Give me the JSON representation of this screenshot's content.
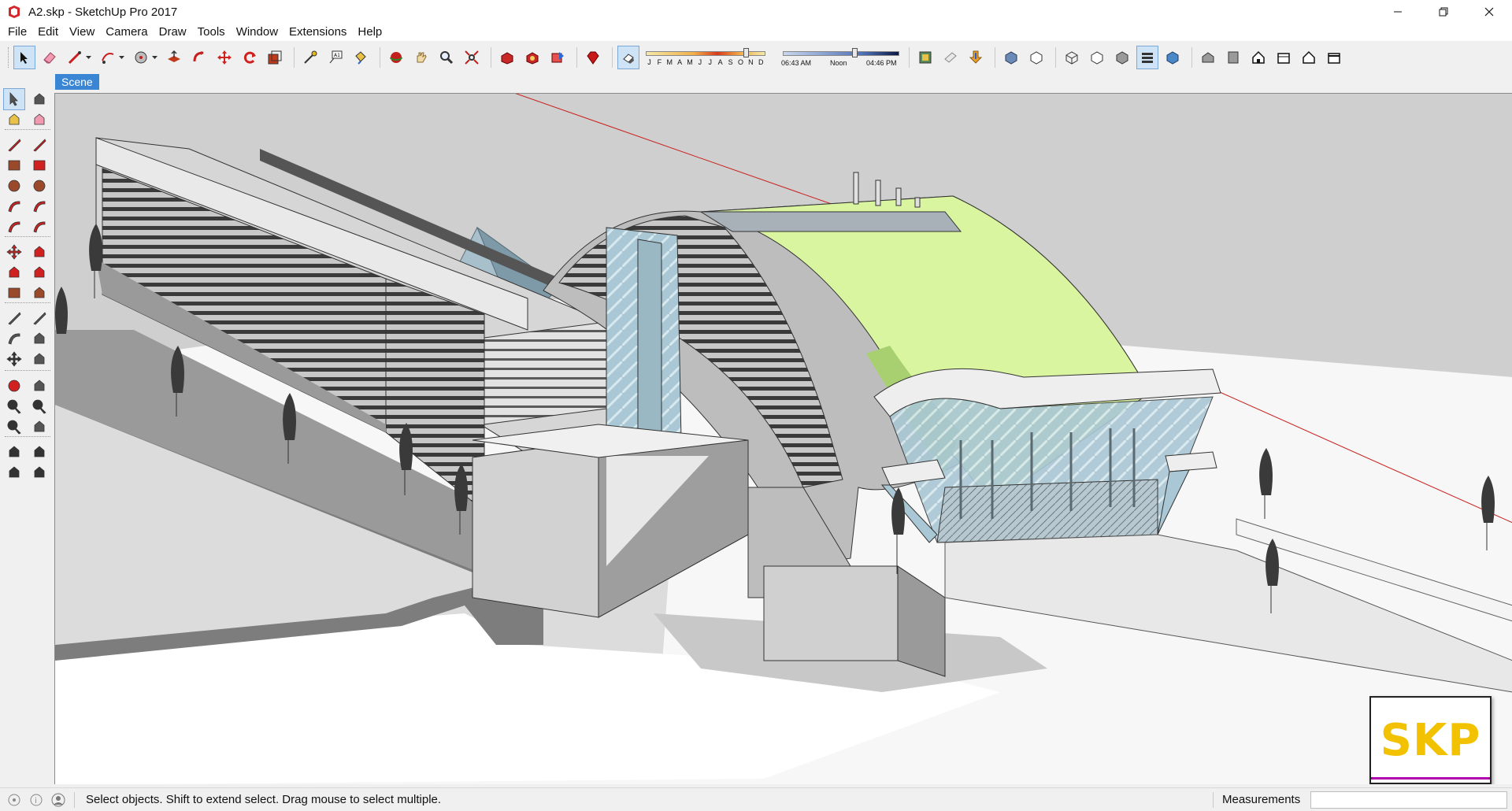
{
  "window": {
    "title": "A2.skp - SketchUp Pro 2017",
    "controls": [
      "minimize",
      "restore",
      "close"
    ]
  },
  "menu": [
    "File",
    "Edit",
    "View",
    "Camera",
    "Draw",
    "Tools",
    "Window",
    "Extensions",
    "Help"
  ],
  "toolbar": {
    "months": [
      "J",
      "F",
      "M",
      "A",
      "M",
      "J",
      "J",
      "A",
      "S",
      "O",
      "N",
      "D"
    ],
    "sunrise_label": "06:43 AM",
    "noon_label": "Noon",
    "sunset_label": "04:46 PM",
    "tool_icons": [
      "select-icon",
      "eraser-icon",
      "line-icon",
      "arc-icon",
      "shape-icon",
      "push-pull-icon",
      "follow-me-icon",
      "move-icon",
      "rotate-icon",
      "scale-icon",
      "tape-measure-icon",
      "text-icon",
      "paint-bucket-icon",
      "orbit-icon",
      "pan-icon",
      "zoom-icon",
      "zoom-extents-icon",
      "warehouse-icon",
      "extension-warehouse-icon",
      "share-model-icon",
      "ruby-icon",
      "shadows-toggle-icon",
      "styles-icon",
      "layers-icon",
      "outliner-icon",
      "views-icon"
    ]
  },
  "scene": {
    "tab_label": "Scene"
  },
  "left_tools": [
    "select-icon",
    "make-component-icon",
    "paint-bucket-icon",
    "eraser-icon",
    "line-icon",
    "freehand-icon",
    "rectangle-icon",
    "rotated-rectangle-icon",
    "circle-icon",
    "polygon-icon",
    "arc-icon",
    "two-point-arc-icon",
    "three-point-arc-icon",
    "pie-icon",
    "move-icon",
    "push-pull-icon",
    "rotate-icon",
    "follow-me-icon",
    "scale-icon",
    "offset-icon",
    "tape-measure-icon",
    "dimension-icon",
    "protractor-icon",
    "text-icon",
    "axes-icon",
    "3d-text-icon",
    "orbit-icon",
    "pan-icon",
    "zoom-icon",
    "zoom-window-icon",
    "zoom-extents-icon",
    "previous-view-icon",
    "position-camera-icon",
    "look-around-icon",
    "walk-icon",
    "section-plane-icon"
  ],
  "status": {
    "message": "Select objects. Shift to extend select. Drag mouse to select multiple.",
    "measurements_label": "Measurements",
    "measurements_value": ""
  },
  "badge": {
    "text": "SKP"
  },
  "colors": {
    "scene_tab": "#3a86d4",
    "green_roof": "#d9f5a0",
    "sky": "#cfcfcf",
    "axis_red": "#c8201c",
    "logo_yellow": "#f2c200"
  }
}
